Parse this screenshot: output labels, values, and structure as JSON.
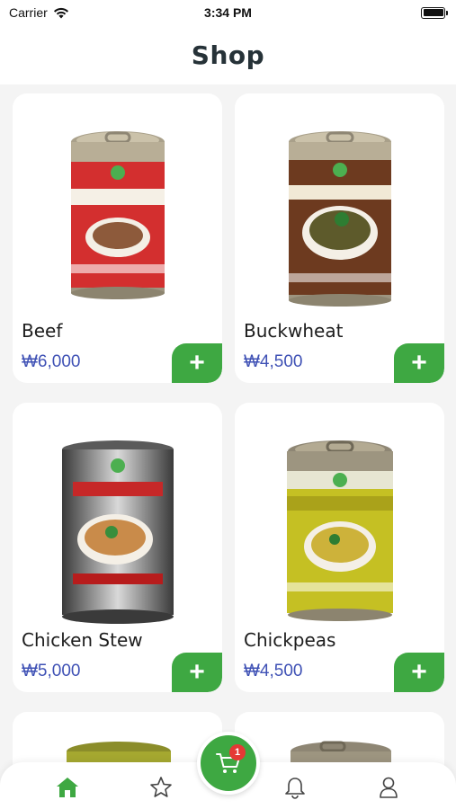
{
  "status_bar": {
    "carrier": "Carrier",
    "time": "3:34 PM"
  },
  "header": {
    "title": "Shop"
  },
  "colors": {
    "accent": "#3ea842",
    "price": "#3f51b5",
    "badge": "#e53935"
  },
  "products": [
    {
      "name": "Beef",
      "price": "₩6,000",
      "add_label": "+"
    },
    {
      "name": "Buckwheat",
      "price": "₩4,500",
      "add_label": "+"
    },
    {
      "name": "Chicken Stew",
      "price": "₩5,000",
      "add_label": "+"
    },
    {
      "name": "Chickpeas",
      "price": "₩4,500",
      "add_label": "+"
    }
  ],
  "tab_bar": {
    "tabs": [
      "home-icon",
      "star-icon",
      "cart-icon",
      "bell-icon",
      "user-icon"
    ],
    "cart_badge": "1"
  }
}
